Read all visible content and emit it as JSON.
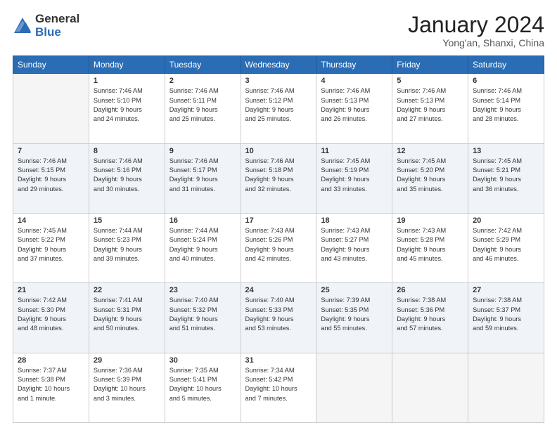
{
  "header": {
    "logo_general": "General",
    "logo_blue": "Blue",
    "month_title": "January 2024",
    "location": "Yong'an, Shanxi, China"
  },
  "days_of_week": [
    "Sunday",
    "Monday",
    "Tuesday",
    "Wednesday",
    "Thursday",
    "Friday",
    "Saturday"
  ],
  "weeks": [
    [
      {
        "day": "",
        "info": ""
      },
      {
        "day": "1",
        "info": "Sunrise: 7:46 AM\nSunset: 5:10 PM\nDaylight: 9 hours\nand 24 minutes."
      },
      {
        "day": "2",
        "info": "Sunrise: 7:46 AM\nSunset: 5:11 PM\nDaylight: 9 hours\nand 25 minutes."
      },
      {
        "day": "3",
        "info": "Sunrise: 7:46 AM\nSunset: 5:12 PM\nDaylight: 9 hours\nand 25 minutes."
      },
      {
        "day": "4",
        "info": "Sunrise: 7:46 AM\nSunset: 5:13 PM\nDaylight: 9 hours\nand 26 minutes."
      },
      {
        "day": "5",
        "info": "Sunrise: 7:46 AM\nSunset: 5:13 PM\nDaylight: 9 hours\nand 27 minutes."
      },
      {
        "day": "6",
        "info": "Sunrise: 7:46 AM\nSunset: 5:14 PM\nDaylight: 9 hours\nand 28 minutes."
      }
    ],
    [
      {
        "day": "7",
        "info": "Sunrise: 7:46 AM\nSunset: 5:15 PM\nDaylight: 9 hours\nand 29 minutes."
      },
      {
        "day": "8",
        "info": "Sunrise: 7:46 AM\nSunset: 5:16 PM\nDaylight: 9 hours\nand 30 minutes."
      },
      {
        "day": "9",
        "info": "Sunrise: 7:46 AM\nSunset: 5:17 PM\nDaylight: 9 hours\nand 31 minutes."
      },
      {
        "day": "10",
        "info": "Sunrise: 7:46 AM\nSunset: 5:18 PM\nDaylight: 9 hours\nand 32 minutes."
      },
      {
        "day": "11",
        "info": "Sunrise: 7:45 AM\nSunset: 5:19 PM\nDaylight: 9 hours\nand 33 minutes."
      },
      {
        "day": "12",
        "info": "Sunrise: 7:45 AM\nSunset: 5:20 PM\nDaylight: 9 hours\nand 35 minutes."
      },
      {
        "day": "13",
        "info": "Sunrise: 7:45 AM\nSunset: 5:21 PM\nDaylight: 9 hours\nand 36 minutes."
      }
    ],
    [
      {
        "day": "14",
        "info": "Sunrise: 7:45 AM\nSunset: 5:22 PM\nDaylight: 9 hours\nand 37 minutes."
      },
      {
        "day": "15",
        "info": "Sunrise: 7:44 AM\nSunset: 5:23 PM\nDaylight: 9 hours\nand 39 minutes."
      },
      {
        "day": "16",
        "info": "Sunrise: 7:44 AM\nSunset: 5:24 PM\nDaylight: 9 hours\nand 40 minutes."
      },
      {
        "day": "17",
        "info": "Sunrise: 7:43 AM\nSunset: 5:26 PM\nDaylight: 9 hours\nand 42 minutes."
      },
      {
        "day": "18",
        "info": "Sunrise: 7:43 AM\nSunset: 5:27 PM\nDaylight: 9 hours\nand 43 minutes."
      },
      {
        "day": "19",
        "info": "Sunrise: 7:43 AM\nSunset: 5:28 PM\nDaylight: 9 hours\nand 45 minutes."
      },
      {
        "day": "20",
        "info": "Sunrise: 7:42 AM\nSunset: 5:29 PM\nDaylight: 9 hours\nand 46 minutes."
      }
    ],
    [
      {
        "day": "21",
        "info": "Sunrise: 7:42 AM\nSunset: 5:30 PM\nDaylight: 9 hours\nand 48 minutes."
      },
      {
        "day": "22",
        "info": "Sunrise: 7:41 AM\nSunset: 5:31 PM\nDaylight: 9 hours\nand 50 minutes."
      },
      {
        "day": "23",
        "info": "Sunrise: 7:40 AM\nSunset: 5:32 PM\nDaylight: 9 hours\nand 51 minutes."
      },
      {
        "day": "24",
        "info": "Sunrise: 7:40 AM\nSunset: 5:33 PM\nDaylight: 9 hours\nand 53 minutes."
      },
      {
        "day": "25",
        "info": "Sunrise: 7:39 AM\nSunset: 5:35 PM\nDaylight: 9 hours\nand 55 minutes."
      },
      {
        "day": "26",
        "info": "Sunrise: 7:38 AM\nSunset: 5:36 PM\nDaylight: 9 hours\nand 57 minutes."
      },
      {
        "day": "27",
        "info": "Sunrise: 7:38 AM\nSunset: 5:37 PM\nDaylight: 9 hours\nand 59 minutes."
      }
    ],
    [
      {
        "day": "28",
        "info": "Sunrise: 7:37 AM\nSunset: 5:38 PM\nDaylight: 10 hours\nand 1 minute."
      },
      {
        "day": "29",
        "info": "Sunrise: 7:36 AM\nSunset: 5:39 PM\nDaylight: 10 hours\nand 3 minutes."
      },
      {
        "day": "30",
        "info": "Sunrise: 7:35 AM\nSunset: 5:41 PM\nDaylight: 10 hours\nand 5 minutes."
      },
      {
        "day": "31",
        "info": "Sunrise: 7:34 AM\nSunset: 5:42 PM\nDaylight: 10 hours\nand 7 minutes."
      },
      {
        "day": "",
        "info": ""
      },
      {
        "day": "",
        "info": ""
      },
      {
        "day": "",
        "info": ""
      }
    ]
  ]
}
